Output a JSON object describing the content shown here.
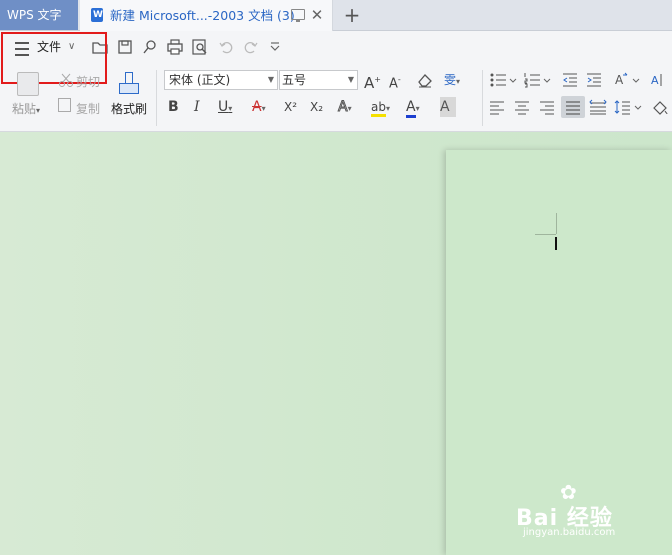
{
  "tabs": {
    "app_tab": "WPS 文字",
    "doc_tab": "新建 Microsoft...-2003 文档 (3)",
    "close": "✕",
    "new": "+"
  },
  "quickbar": {
    "file_menu": "文件",
    "chevron": "∨"
  },
  "clipboard": {
    "paste": "粘贴",
    "cut": "剪切",
    "copy": "复制",
    "format_painter": "格式刷"
  },
  "font": {
    "family": "宋体 (正文)",
    "size": "五号"
  },
  "icons": {
    "grow_font": "A",
    "shrink_font": "A",
    "clear_format": "◇",
    "phonetic": "雯",
    "bold": "B",
    "italic": "I",
    "underline": "U",
    "strike": "A",
    "superscript": "X²",
    "subscript": "X₂",
    "text_effect": "A",
    "highlight": "ab",
    "font_color": "A",
    "char_shading": "A"
  },
  "watermark": {
    "brand": "Bai 经验",
    "url": "jingyan.baidu.com"
  },
  "colors": {
    "accent": "#2a66c4",
    "app_tab": "#6f8fc6",
    "highlight_box": "#e21b1b",
    "document_bg": "#cde8cb"
  }
}
